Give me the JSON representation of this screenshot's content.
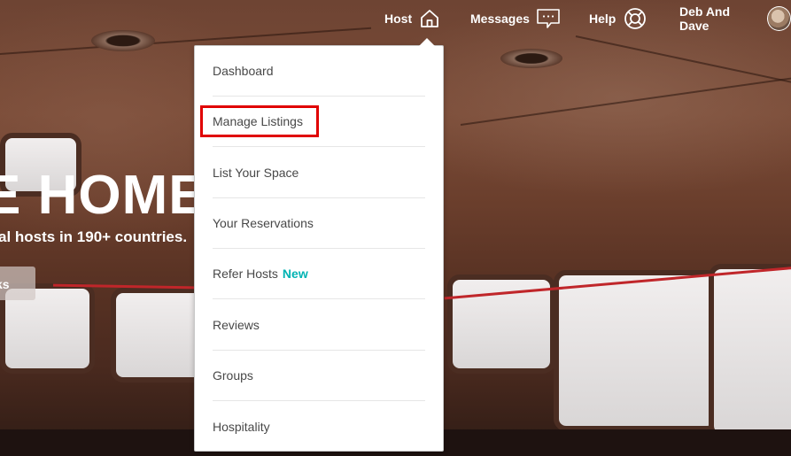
{
  "hero": {
    "title": "E HOME",
    "subtitle": "al hosts in 190+ countries.",
    "button_label": "ks"
  },
  "nav": {
    "host_label": "Host",
    "host_icon": "home-icon",
    "messages_label": "Messages",
    "messages_icon": "chat-bubble-icon",
    "help_label": "Help",
    "help_icon": "life-ring-icon",
    "user_label": "Deb And Dave",
    "user_icon": "avatar"
  },
  "host_menu": {
    "items": [
      {
        "label": "Dashboard"
      },
      {
        "label": "Manage Listings"
      },
      {
        "label": "List Your Space"
      },
      {
        "label": "Your Reservations"
      },
      {
        "label": "Refer Hosts",
        "badge": "New"
      },
      {
        "label": "Reviews"
      },
      {
        "label": "Groups"
      },
      {
        "label": "Hospitality"
      }
    ],
    "highlighted_item": "Manage Listings"
  },
  "colors": {
    "badge_new": "#00b3b3",
    "highlight_border": "#e00000",
    "menu_text": "#484848",
    "nav_text": "#ffffff"
  }
}
